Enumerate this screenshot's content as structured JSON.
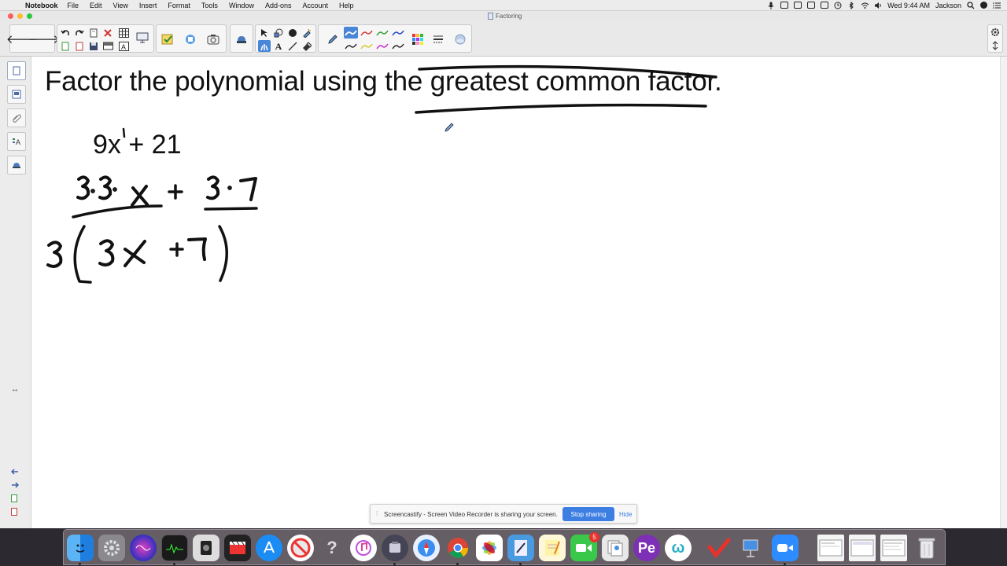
{
  "menubar": {
    "apple_glyph": "",
    "menus": [
      "Notebook",
      "File",
      "Edit",
      "View",
      "Insert",
      "Format",
      "Tools",
      "Window",
      "Add-ons",
      "Account",
      "Help"
    ],
    "clock": "Wed 9:44 AM",
    "user": "Jackson"
  },
  "window": {
    "title": "Factoring"
  },
  "toolbar": {
    "back_glyph": "🡐",
    "forward_glyph": "🡒",
    "pen_colors": [
      "#1a3cc8",
      "#d03030",
      "#2a9a2a",
      "#1a3cc8",
      "#222222",
      "#d8c820",
      "#d020c8",
      "#222222"
    ],
    "selected_tool": "pens"
  },
  "sidebar": {
    "tabs": [
      "page-sorter",
      "gallery",
      "attachments",
      "properties",
      "add-ons"
    ],
    "expand_glyph": "↔"
  },
  "canvas": {
    "heading_before": "Factor the polynomial using the ",
    "heading_underlined": "greatest common factor.",
    "expression": "9x + 21",
    "ink_color": "#111111"
  },
  "sharing": {
    "message": "Screencastify - Screen Video Recorder is sharing your screen.",
    "stop_label": "Stop sharing",
    "hide_label": "Hide"
  },
  "dock": {
    "apps": [
      "finder",
      "system-preferences",
      "siri",
      "activity-monitor",
      "screenshot",
      "final-cut",
      "app-store",
      "news",
      "help",
      "itunes",
      "notebook-app",
      "safari",
      "chrome",
      "photos",
      "notebook-doc",
      "notes",
      "facetime",
      "preview",
      "pe",
      "word-app",
      "checkmark-app",
      "keynote",
      "zoom",
      "doc1",
      "doc2",
      "doc3",
      "trash"
    ],
    "facetime_badge": "5"
  }
}
